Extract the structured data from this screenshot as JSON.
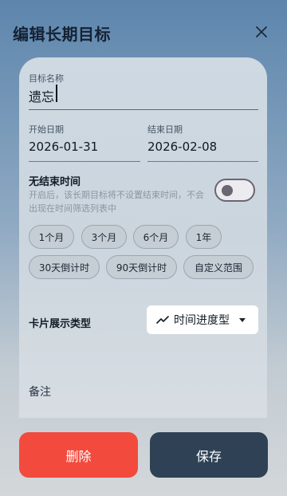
{
  "header": {
    "title": "编辑长期目标",
    "close_icon": "close-icon"
  },
  "form": {
    "goal_name": {
      "label": "目标名称",
      "value": "遗忘"
    },
    "start_date": {
      "label": "开始日期",
      "value": "2026-01-31"
    },
    "end_date": {
      "label": "结束日期",
      "value": "2026-02-08"
    },
    "no_end": {
      "title": "无结束时间",
      "description": "开启后，该长期目标将不设置结束时间，不会出现在时间筛选列表中",
      "enabled": false
    },
    "presets": {
      "row1": [
        "1个月",
        "3个月",
        "6个月",
        "1年"
      ],
      "row2": [
        "30天倒计时",
        "90天倒计时",
        "自定义范围"
      ]
    },
    "card_type": {
      "label": "卡片展示类型",
      "icon": "trending-up-icon",
      "value": "时间进度型"
    },
    "notes_label": "备注"
  },
  "actions": {
    "delete_label": "删除",
    "save_label": "保存"
  },
  "colors": {
    "delete": "#f24a3d",
    "save": "#2f4255",
    "title": "#152234"
  }
}
